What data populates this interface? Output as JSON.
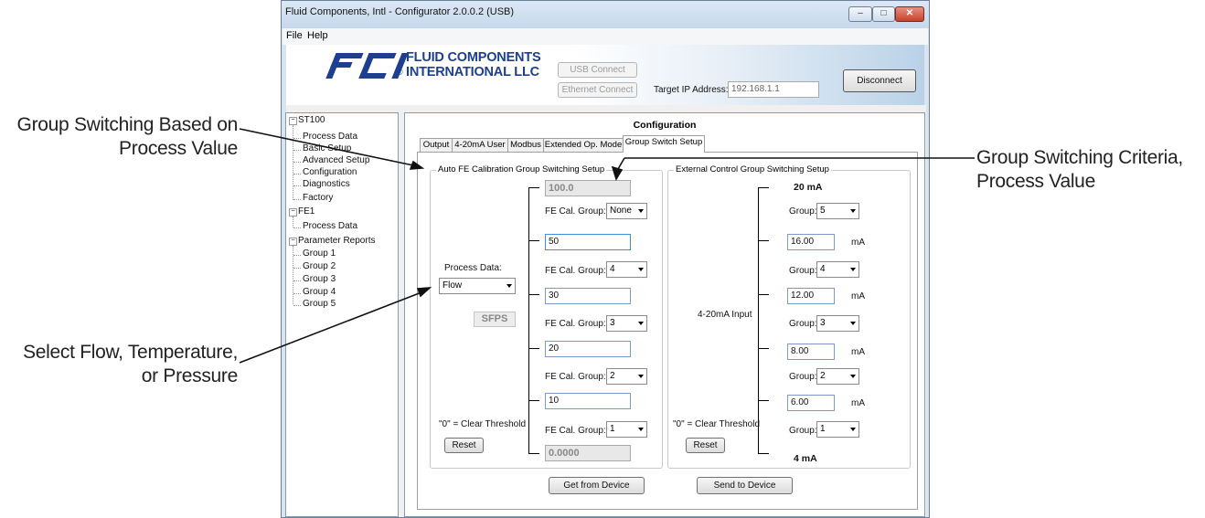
{
  "callouts": {
    "group_switching_1": "Group Switching Based on",
    "group_switching_2": "Process Value",
    "select_1": "Select Flow, Temperature,",
    "select_2": "or Pressure",
    "criteria_1": "Group Switching Criteria,",
    "criteria_2": "Process Value"
  },
  "window": {
    "title": "Fluid Components, Intl - Configurator 2.0.0.2 (USB)",
    "menu": [
      "File",
      "Help"
    ],
    "controls": {
      "minimize": "–",
      "maximize": "□",
      "close": "✕"
    },
    "close_color": "#c8402d"
  },
  "header": {
    "logo_mark": "FCI",
    "logo_line1": "FLUID COMPONENTS",
    "logo_line2": "INTERNATIONAL LLC",
    "logo_reg": "®",
    "usb_connect": "USB Connect",
    "ethernet_connect": "Ethernet Connect",
    "target_ip_label": "Target IP Address:",
    "target_ip_value": "192.168.1.1",
    "disconnect": "Disconnect",
    "brand_color": "#1e3f8f"
  },
  "tree": {
    "root": "ST100",
    "root_children": [
      "Process Data",
      "Basic Setup",
      "Advanced Setup",
      "Configuration",
      "Diagnostics",
      "Factory"
    ],
    "fe1": "FE1",
    "fe1_children": [
      "Process Data"
    ],
    "reports": "Parameter Reports",
    "reports_children": [
      "Group 1",
      "Group 2",
      "Group 3",
      "Group 4",
      "Group 5"
    ]
  },
  "main": {
    "heading": "Configuration",
    "tabs": [
      "Output",
      "4-20mA User",
      "Modbus",
      "Extended Op. Mode",
      "Group Switch Setup"
    ],
    "active_tab": "Group Switch Setup"
  },
  "auto": {
    "title": "Auto FE Calibration Group Switching Setup",
    "process_data_label": "Process Data:",
    "process_data_value": "Flow",
    "units": "SFPS",
    "clear_note": "\"0\" = Clear Threshold",
    "reset": "Reset",
    "top_value": "100.0",
    "bottom_value": "0.0000",
    "thresholds": [
      "50",
      "30",
      "20",
      "10"
    ],
    "group_label": "FE Cal. Group:",
    "groups": [
      "None",
      "4",
      "3",
      "2",
      "1"
    ]
  },
  "external": {
    "title": "External Control Group Switching Setup",
    "top_label": "20 mA",
    "bottom_label": "4 mA",
    "input_label": "4-20mA Input",
    "clear_note": "\"0\" = Clear Threshold",
    "reset": "Reset",
    "group_label": "Group:",
    "groups": [
      "5",
      "4",
      "3",
      "2",
      "1"
    ],
    "thresholds": [
      "16.00",
      "12.00",
      "8.00",
      "6.00"
    ],
    "unit": "mA"
  },
  "footer": {
    "get": "Get from Device",
    "send": "Send to Device"
  }
}
